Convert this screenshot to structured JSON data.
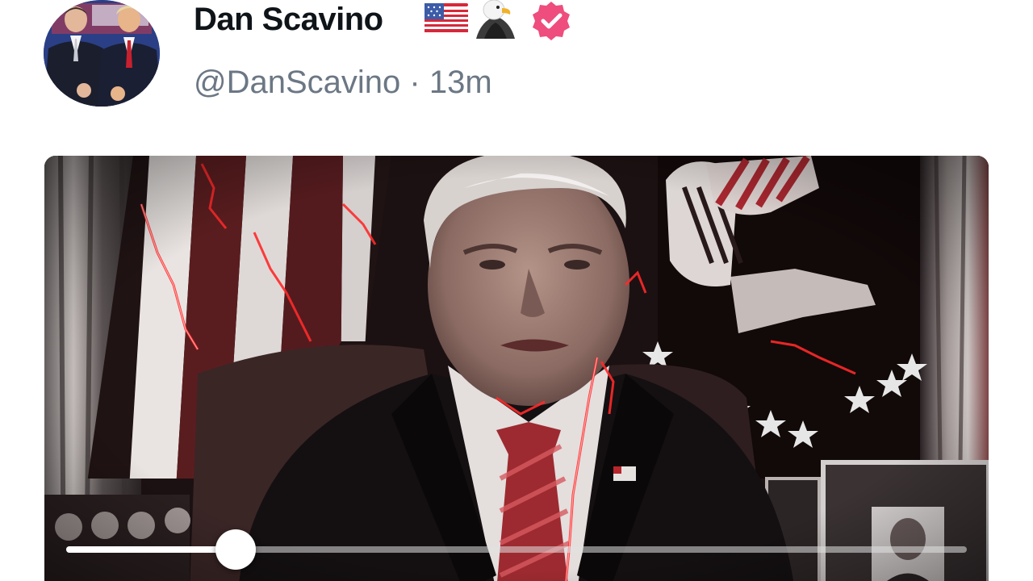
{
  "post": {
    "author_name": "Dan Scavino",
    "name_emojis": [
      "us-flag",
      "eagle"
    ],
    "verified": true,
    "handle": "@DanScavino",
    "separator": "·",
    "time_ago": "13m"
  },
  "video": {
    "progress": 0.188,
    "icons": {
      "verified": "verified-badge-icon",
      "scrubber_thumb": "scrubber-handle"
    }
  },
  "colors": {
    "verified_badge": "#ee4d7d",
    "name_text": "#0f1419",
    "meta_text": "#6b7784",
    "lightning": "#ff2a2a"
  }
}
